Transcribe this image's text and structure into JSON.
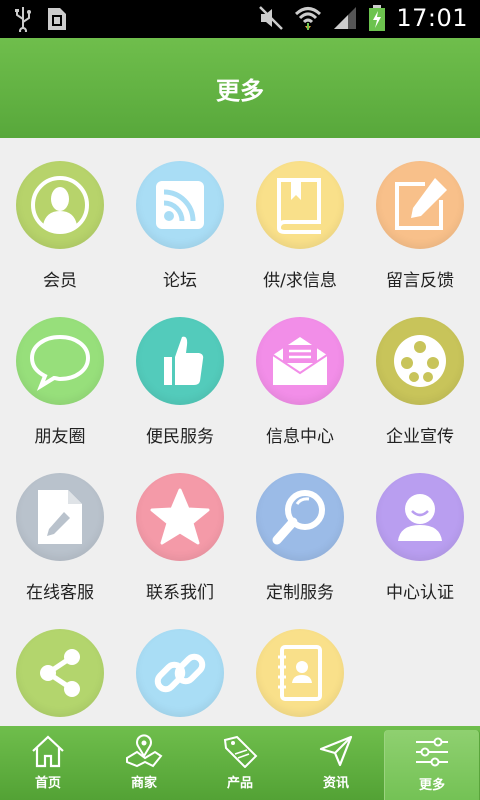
{
  "status_bar": {
    "time": "17:01"
  },
  "header": {
    "title": "更多"
  },
  "items": [
    {
      "label": "会员",
      "icon": "member-icon",
      "color": "#b7d36b"
    },
    {
      "label": "论坛",
      "icon": "rss-icon",
      "color": "#a9ddf5"
    },
    {
      "label": "供/求信息",
      "icon": "book-icon",
      "color": "#f9e08a"
    },
    {
      "label": "留言反馈",
      "icon": "edit-icon",
      "color": "#f8c08a"
    },
    {
      "label": "朋友圈",
      "icon": "chat-bubble-icon",
      "color": "#97df7b"
    },
    {
      "label": "便民服务",
      "icon": "thumbs-up-icon",
      "color": "#53cbbb"
    },
    {
      "label": "信息中心",
      "icon": "envelope-icon",
      "color": "#f28ee8"
    },
    {
      "label": "企业宣传",
      "icon": "film-reel-icon",
      "color": "#c8c45a"
    },
    {
      "label": "在线客服",
      "icon": "document-edit-icon",
      "color": "#b9c2cc"
    },
    {
      "label": "联系我们",
      "icon": "star-icon",
      "color": "#f49aa8"
    },
    {
      "label": "定制服务",
      "icon": "magnifier-icon",
      "color": "#9bbbe7"
    },
    {
      "label": "中心认证",
      "icon": "user-avatar-icon",
      "color": "#b99ef0"
    },
    {
      "label": "",
      "icon": "share-icon",
      "color": "#b3d56d"
    },
    {
      "label": "",
      "icon": "link-icon",
      "color": "#a9ddf5"
    },
    {
      "label": "",
      "icon": "contact-book-icon",
      "color": "#f9e08a"
    }
  ],
  "tabs": [
    {
      "label": "首页",
      "icon": "home-icon",
      "active": false
    },
    {
      "label": "商家",
      "icon": "map-icon",
      "active": false
    },
    {
      "label": "产品",
      "icon": "sale-tag-icon",
      "active": false
    },
    {
      "label": "资讯",
      "icon": "paper-plane-icon",
      "active": false
    },
    {
      "label": "更多",
      "icon": "settings-sliders-icon",
      "active": true
    }
  ]
}
